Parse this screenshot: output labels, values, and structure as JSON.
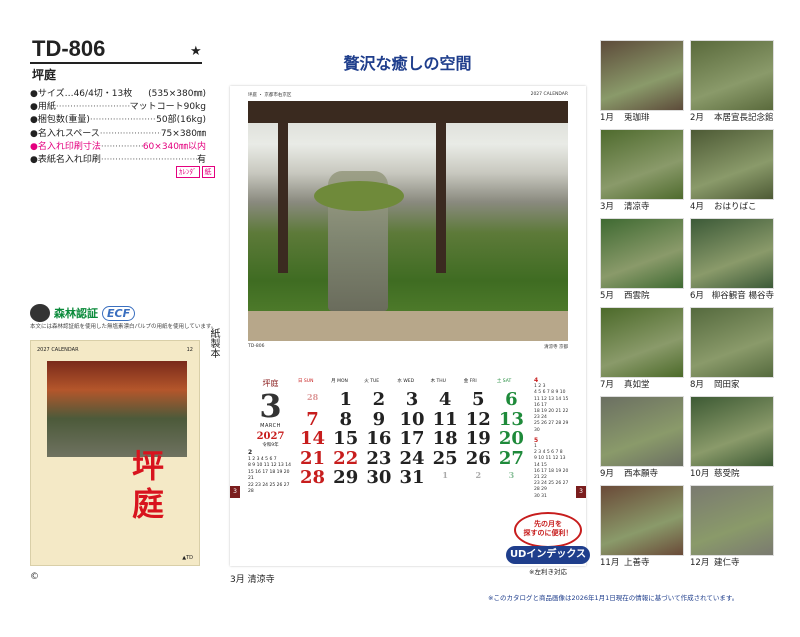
{
  "product": {
    "model": "TD-806",
    "star": "★",
    "name": "坪庭"
  },
  "specs": [
    {
      "k": "●サイズ…46/4切・13枚",
      "dots": "",
      "v": "(535×380㎜)",
      "pink": false
    },
    {
      "k": "●用紙",
      "dots": "·································",
      "v": "マットコート90kg",
      "pink": false
    },
    {
      "k": "●梱包数(重量)",
      "dots": "······························",
      "v": "50部(16kg)",
      "pink": false
    },
    {
      "k": "●名入れスペース",
      "dots": "·························",
      "v": "75×380㎜",
      "pink": false
    },
    {
      "k": "●名入れ印刷寸法",
      "dots": "·························",
      "v": "60×340㎜以内",
      "pink": true
    },
    {
      "k": "●表紙名入れ印刷",
      "dots": "·······································",
      "v": "有",
      "pink": false
    }
  ],
  "badges": [
    "ｶﾚﾝﾀﾞ",
    "紙"
  ],
  "certification": {
    "mark": "森林認証",
    "ecf": "ECF",
    "note": "本文には森林認証紙を使用した無塩素漂白パルプの用紙を使用しています。",
    "vertical": "紙製本"
  },
  "cover": {
    "header_left": "2027 CALENDAR",
    "header_right": "12",
    "title": "坪庭",
    "footer": "▲TD"
  },
  "copyright": "©",
  "headline": "贅沢な癒しの空間",
  "calendar": {
    "strip_left": "坪庭 ・ 京都市右京区",
    "strip_right": "2027 CALENDAR",
    "caption_left": "TD-806",
    "caption_right": "清涼寺 京都",
    "label": "坪庭",
    "month_num": "3",
    "month_en": "MARCH",
    "year": "2027",
    "year_sub": "令和9年",
    "weekdays": [
      {
        "n": "日 SUN",
        "c": "sun"
      },
      {
        "n": "月 MON",
        "c": ""
      },
      {
        "n": "火 TUE",
        "c": ""
      },
      {
        "n": "水 WED",
        "c": ""
      },
      {
        "n": "木 THU",
        "c": ""
      },
      {
        "n": "金 FRI",
        "c": ""
      },
      {
        "n": "土 SAT",
        "c": "sat"
      }
    ],
    "dates": [
      {
        "t": "28",
        "c": "gray sun"
      },
      {
        "t": "1",
        "c": ""
      },
      {
        "t": "2",
        "c": ""
      },
      {
        "t": "3",
        "c": ""
      },
      {
        "t": "4",
        "c": ""
      },
      {
        "t": "5",
        "c": ""
      },
      {
        "t": "6",
        "c": "green"
      },
      {
        "t": "7",
        "c": "red"
      },
      {
        "t": "8",
        "c": ""
      },
      {
        "t": "9",
        "c": ""
      },
      {
        "t": "10",
        "c": ""
      },
      {
        "t": "11",
        "c": ""
      },
      {
        "t": "12",
        "c": ""
      },
      {
        "t": "13",
        "c": "green"
      },
      {
        "t": "14",
        "c": "red"
      },
      {
        "t": "15",
        "c": ""
      },
      {
        "t": "16",
        "c": ""
      },
      {
        "t": "17",
        "c": ""
      },
      {
        "t": "18",
        "c": ""
      },
      {
        "t": "19",
        "c": ""
      },
      {
        "t": "20",
        "c": "green"
      },
      {
        "t": "21",
        "c": "red"
      },
      {
        "t": "22",
        "c": "red"
      },
      {
        "t": "23",
        "c": ""
      },
      {
        "t": "24",
        "c": ""
      },
      {
        "t": "25",
        "c": ""
      },
      {
        "t": "26",
        "c": ""
      },
      {
        "t": "27",
        "c": "green"
      },
      {
        "t": "28",
        "c": "red"
      },
      {
        "t": "29",
        "c": ""
      },
      {
        "t": "30",
        "c": ""
      },
      {
        "t": "31",
        "c": ""
      },
      {
        "t": "1",
        "c": "gray"
      },
      {
        "t": "2",
        "c": "gray"
      },
      {
        "t": "3",
        "c": "gray sat"
      }
    ],
    "prev_mini_title": "2",
    "prev_mini": [
      "1 2 3 4 5 6 7",
      "8 9 10 11 12 13 14",
      "15 16 17 18 19 20 21",
      "22 23 24 25 26 27 28"
    ],
    "next_mini_title_4": "4",
    "next_mini_4": [
      "1 2 3",
      "4 5 6 7 8 9 10",
      "11 12 13 14 15 16 17",
      "18 19 20 21 22 23 24",
      "25 26 27 28 29 30"
    ],
    "next_mini_title_5": "5",
    "next_mini_5": [
      "1",
      "2 3 4 5 6 7 8",
      "9 10 11 12 13 14 15",
      "16 17 18 19 20 21 22",
      "23 24 25 26 27 28 29",
      "30 31"
    ],
    "tab": "3",
    "footer": "3月 清涼寺"
  },
  "ud_badge": {
    "top_line1": "先の月を",
    "top_line2": "探すのに便利！",
    "middle": "UDインデックス",
    "bottom": "※左利き対応"
  },
  "thumbnails": [
    {
      "month": "1月",
      "name": "兎珈琲",
      "color": "#5d4b3a"
    },
    {
      "month": "2月",
      "name": "本居宣長記念館",
      "color": "#5a6a3c"
    },
    {
      "month": "3月",
      "name": "清凉寺",
      "color": "#4f6b2e"
    },
    {
      "month": "4月",
      "name": "おはりばこ",
      "color": "#4d5a35"
    },
    {
      "month": "5月",
      "name": "西雲院",
      "color": "#3f6a32"
    },
    {
      "month": "6月",
      "name": "柳谷観音 楊谷寺",
      "color": "#3c5a38"
    },
    {
      "month": "7月",
      "name": "真如堂",
      "color": "#4c6a2a"
    },
    {
      "month": "8月",
      "name": "岡田家",
      "color": "#556a3e"
    },
    {
      "month": "9月",
      "name": "西本願寺",
      "color": "#6b6f62"
    },
    {
      "month": "10月",
      "name": "慈受院",
      "color": "#3d5a34"
    },
    {
      "month": "11月",
      "name": "上善寺",
      "color": "#6a4a38"
    },
    {
      "month": "12月",
      "name": "建仁寺",
      "color": "#7a7a70"
    }
  ],
  "footnote": "※このカタログと商品画像は2026年1月1日現在の情報に基づいて作成されています。"
}
